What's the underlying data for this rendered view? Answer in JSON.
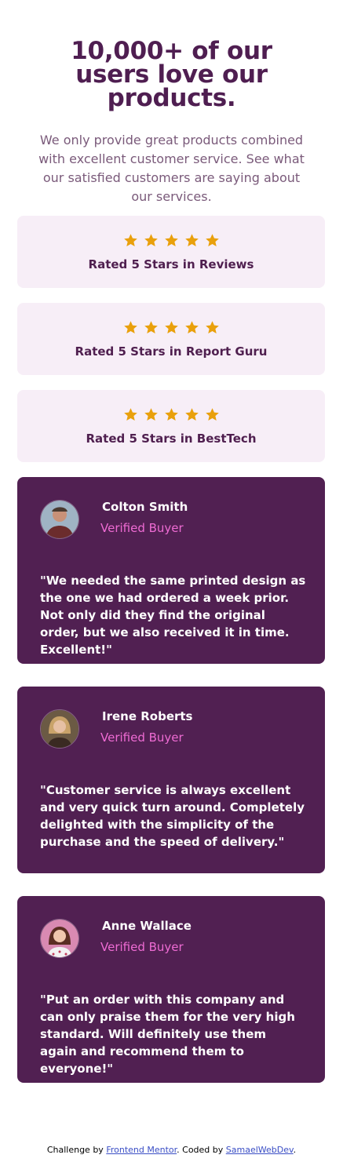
{
  "hero": {
    "title": "10,000+ of our users love our products.",
    "subtitle": "We only provide great products combined with excellent customer service. See what our satisfied customers are saying about our services."
  },
  "ratings": [
    {
      "label": "Rated 5 Stars in Reviews",
      "stars": 5
    },
    {
      "label": "Rated 5 Stars in Report Guru",
      "stars": 5
    },
    {
      "label": "Rated 5 Stars in BestTech",
      "stars": 5
    }
  ],
  "testimonials": [
    {
      "name": "Colton Smith",
      "role": "Verified Buyer",
      "quote": "\"We needed the same printed design as the one we had ordered a week prior. Not only did they find the original order, but we also received it in time. Excellent!\""
    },
    {
      "name": "Irene Roberts",
      "role": "Verified Buyer",
      "quote": "\"Customer service is always excellent and very quick turn around. Completely delighted with the simplicity of the purchase and the speed of delivery.\""
    },
    {
      "name": "Anne Wallace",
      "role": "Verified Buyer",
      "quote": "\"Put an order with this company and can only praise them for the very high standard. Will definitely use them again and recommend them to everyone!\""
    }
  ],
  "footer": {
    "prefix": "Challenge by ",
    "link1": "Frontend Mentor",
    "middle": ". Coded by ",
    "link2": "SamaelWebDev",
    "suffix": "."
  },
  "colors": {
    "accent": "#512052",
    "rating_bg": "#f7eef7",
    "star": "#e9a00c",
    "buyer": "#ee6bd3"
  }
}
